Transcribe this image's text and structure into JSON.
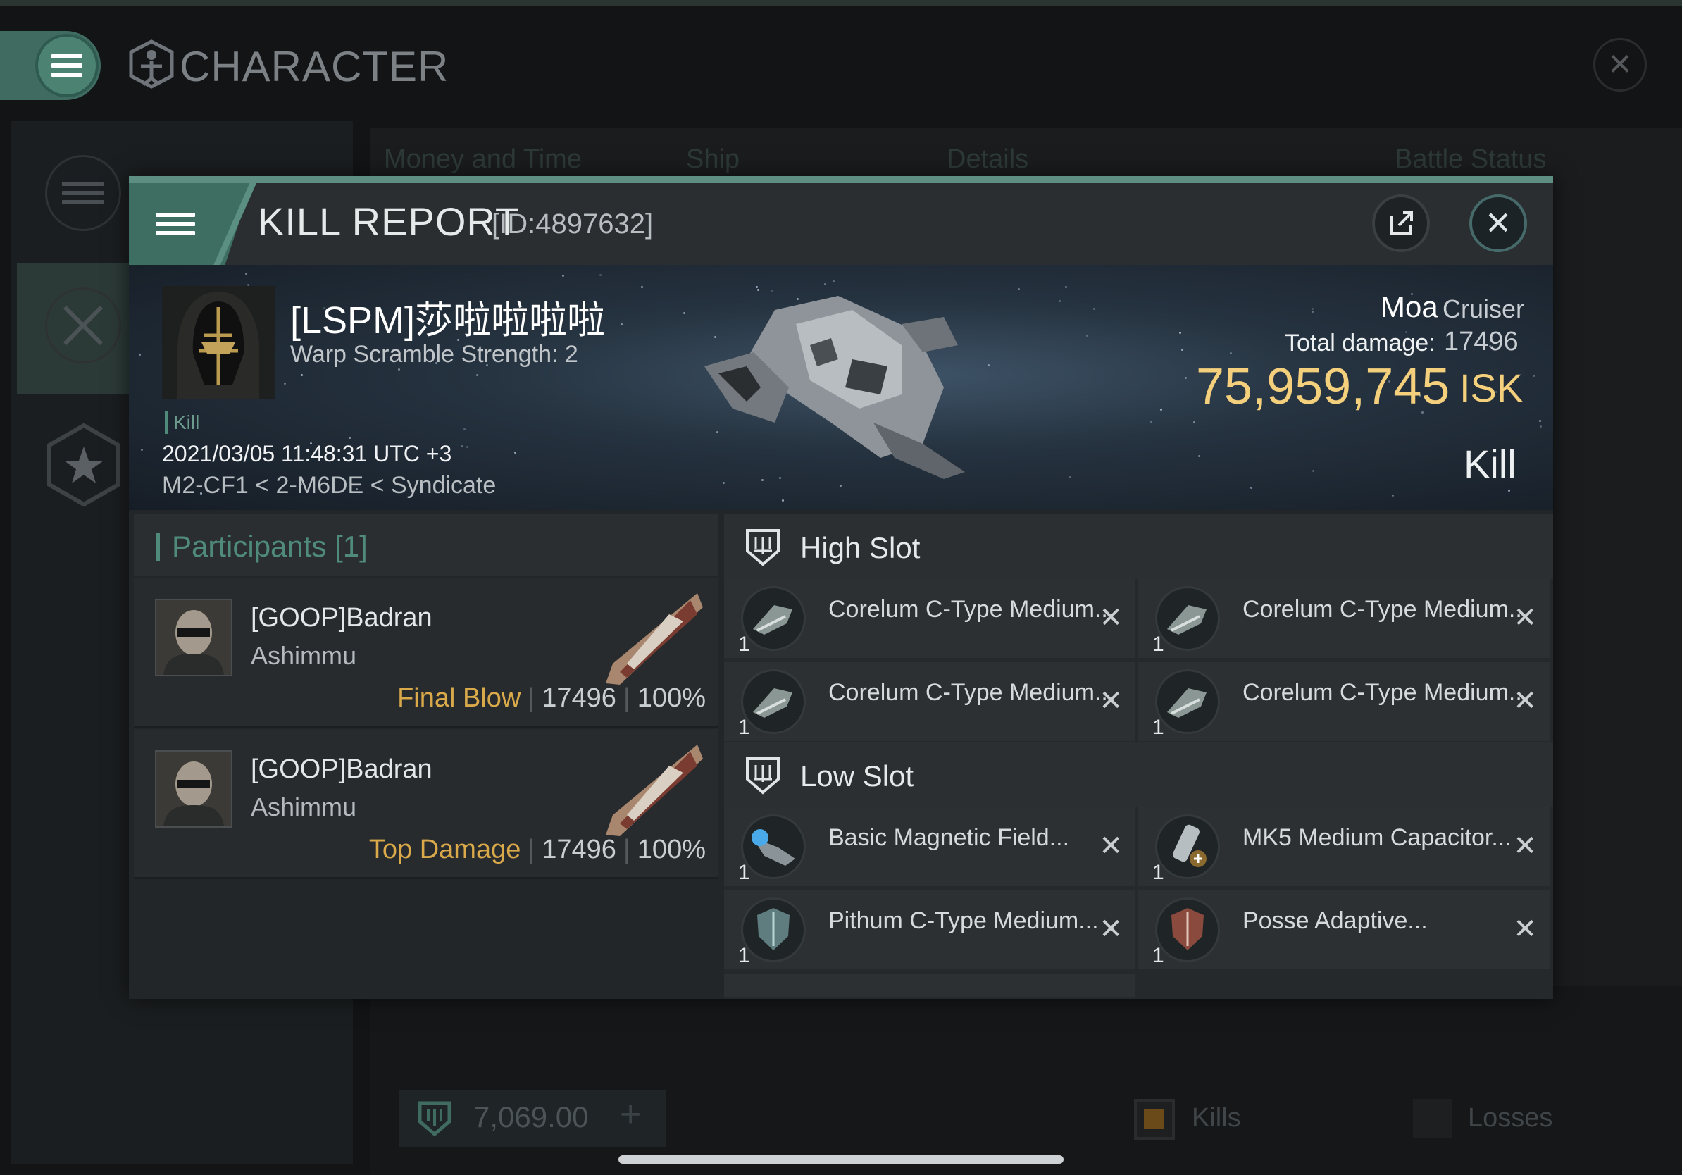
{
  "background_window": {
    "title": "CHARACTER",
    "tabs": [
      "Money and Time",
      "Ship",
      "Details",
      "Battle Status"
    ],
    "wallet_value": "7,069.00",
    "filter_kills": "Kills",
    "filter_losses": "Losses"
  },
  "kill_report": {
    "title": "KILL REPORT",
    "id_label": "[ID:4897632]",
    "victim": {
      "name": "[LSPM]莎啦啦啦啦",
      "warp_scramble": "Warp Scramble Strength: 2",
      "tag": "Kill",
      "timestamp": "2021/03/05 11:48:31 UTC +3",
      "location": "M2-CF1 < 2-M6DE < Syndicate"
    },
    "ship": {
      "name": "Moa",
      "class": "Cruiser",
      "total_damage_label": "Total damage:",
      "total_damage": "17496",
      "isk_value": "75,959,745",
      "isk_unit": "ISK",
      "status": "Kill"
    },
    "participants": {
      "title": "Participants [1]",
      "rows": [
        {
          "name": "[GOOP]Badran",
          "ship": "Ashimmu",
          "role": "Final Blow",
          "damage": "17496",
          "percent": "100%"
        },
        {
          "name": "[GOOP]Badran",
          "ship": "Ashimmu",
          "role": "Top Damage",
          "damage": "17496",
          "percent": "100%"
        }
      ]
    },
    "high_slot": {
      "title": "High Slot",
      "modules": [
        {
          "name": "Corelum C-Type Medium...",
          "qty": "1"
        },
        {
          "name": "Corelum C-Type Medium...",
          "qty": "1"
        },
        {
          "name": "Corelum C-Type Medium...",
          "qty": "1"
        },
        {
          "name": "Corelum C-Type Medium...",
          "qty": "1"
        }
      ]
    },
    "low_slot": {
      "title": "Low Slot",
      "modules": [
        {
          "name": "Basic Magnetic Field...",
          "qty": "1"
        },
        {
          "name": "MK5 Medium Capacitor...",
          "qty": "1"
        },
        {
          "name": "Pithum C-Type Medium...",
          "qty": "1"
        },
        {
          "name": "Posse Adaptive...",
          "qty": "1"
        }
      ]
    },
    "remove_glyph": "✕"
  },
  "colors": {
    "accent": "#4f8a7a",
    "isk_gold": "#f4cf7c",
    "role_gold": "#d9a94a"
  }
}
